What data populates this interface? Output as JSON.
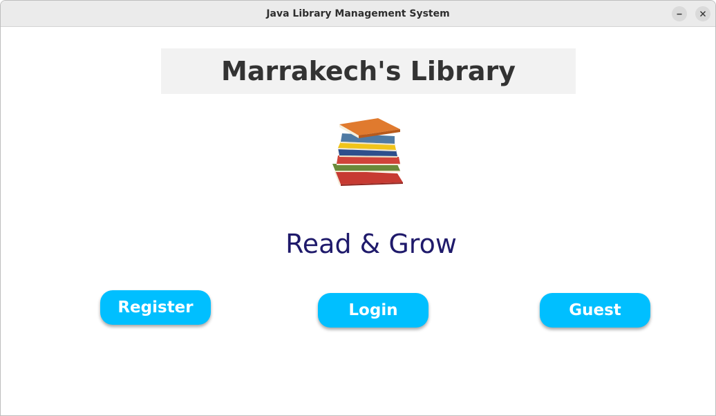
{
  "window": {
    "title": "Java Library Management System",
    "controls": [
      "minimize-icon",
      "close-icon"
    ]
  },
  "header": {
    "title": "Marrakech's Library"
  },
  "logo": {
    "icon": "stack-of-books-icon"
  },
  "tagline": "Read & Grow",
  "buttons": {
    "register": "Register",
    "login": "Login",
    "guest": "Guest"
  },
  "colors": {
    "button_bg": "#00bfff",
    "button_text": "#ffffff",
    "tagline": "#1f1a6b",
    "heading_bg": "#f2f2f2",
    "heading_text": "#333333"
  }
}
